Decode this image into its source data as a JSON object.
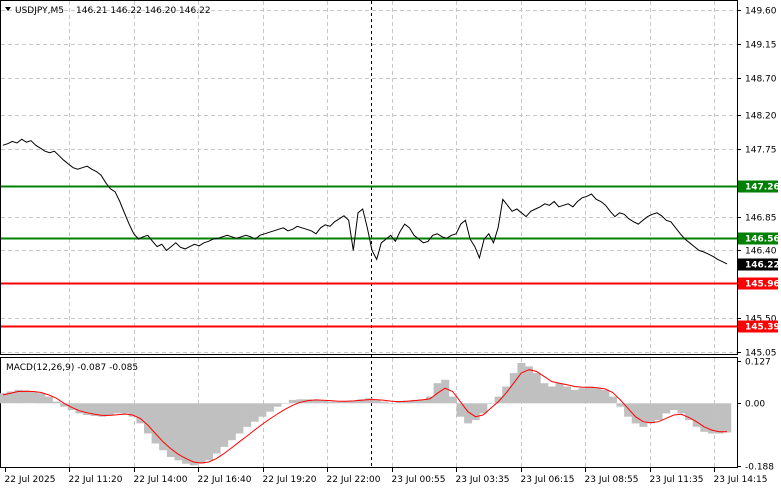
{
  "header": {
    "symbol": "USDJPY,M5",
    "ohlc": "146.21 146.22 146.20 146.22"
  },
  "price_axis": {
    "ticks": [
      "149.60",
      "149.15",
      "148.70",
      "148.20",
      "147.75",
      "147.26",
      "146.85",
      "146.56",
      "146.40",
      "146.22",
      "145.96",
      "145.50",
      "145.39",
      "145.05"
    ],
    "range": [
      145.02,
      149.72
    ]
  },
  "levels": [
    {
      "name": "resistance-upper",
      "value": 147.26,
      "label": "147.26",
      "color": "#008000"
    },
    {
      "name": "resistance-lower",
      "value": 146.56,
      "label": "146.56",
      "color": "#008000"
    },
    {
      "name": "support-upper",
      "value": 145.96,
      "label": "145.96",
      "color": "#ff0000"
    },
    {
      "name": "support-lower",
      "value": 145.39,
      "label": "145.39",
      "color": "#ff0000"
    }
  ],
  "current_price": {
    "label": "146.22",
    "color": "#000000"
  },
  "macd": {
    "title": "MACD(12,26,9) -0.087 -0.085",
    "ticks": [
      "0.127",
      "0.00",
      "-0.188"
    ],
    "range": [
      -0.19,
      0.135
    ],
    "histogram_color": "#c0c0c0",
    "signal_color": "#ff0000"
  },
  "time_axis": {
    "labels": [
      "22 Jul 2025",
      "22 Jul 11:20",
      "22 Jul 14:00",
      "22 Jul 16:40",
      "22 Jul 19:20",
      "22 Jul 22:00",
      "23 Jul 00:55",
      "23 Jul 03:35",
      "23 Jul 06:15",
      "23 Jul 08:55",
      "23 Jul 11:35",
      "23 Jul 14:15"
    ]
  },
  "chart_data": [
    {
      "type": "line",
      "title": "USDJPY,M5",
      "y_range": [
        145.02,
        149.72
      ],
      "x": [
        0,
        3,
        6,
        9,
        12,
        15,
        18,
        21,
        24,
        27,
        30,
        33,
        36,
        39,
        42,
        45,
        48,
        51,
        54,
        57,
        60,
        63,
        66,
        69,
        72,
        75,
        78,
        81,
        84,
        87,
        90,
        93,
        96,
        99,
        102,
        105,
        108,
        111,
        114,
        117,
        120,
        123,
        126,
        129,
        132,
        135,
        138,
        141,
        144,
        147,
        150,
        153,
        156,
        159,
        162,
        165,
        168,
        171,
        174,
        177,
        180,
        183,
        186,
        189,
        192,
        195,
        198,
        201,
        204,
        207,
        210,
        213,
        216,
        219,
        222,
        225,
        228,
        231,
        234,
        237,
        240,
        243,
        246,
        249,
        252,
        255,
        258,
        261,
        264,
        267,
        270,
        273,
        276,
        279,
        282,
        285,
        288,
        291
      ],
      "series": [
        {
          "values": [
            147.8,
            147.82,
            147.85,
            147.83,
            147.88,
            147.84,
            147.86,
            147.8,
            147.76,
            147.72,
            147.7,
            147.72,
            147.66,
            147.6,
            147.55,
            147.5,
            147.48,
            147.5,
            147.52,
            147.48,
            147.45,
            147.4,
            147.3,
            147.22,
            147.18,
            147.05,
            146.9,
            146.75,
            146.62,
            146.55,
            146.58,
            146.6,
            146.52,
            146.45,
            146.48,
            146.4,
            146.45,
            146.5,
            146.44,
            146.42,
            146.45,
            146.48,
            146.46,
            146.5,
            146.52,
            146.55,
            146.56,
            146.58,
            146.6,
            146.58,
            146.56,
            146.58,
            146.6,
            146.58,
            146.55,
            146.6,
            146.62,
            146.64,
            146.66,
            146.68,
            146.7,
            146.66,
            146.68,
            146.72,
            146.7,
            146.68,
            146.66,
            146.62,
            146.7,
            146.74,
            146.72,
            146.78,
            146.82,
            146.86,
            146.8,
            146.4,
            146.9,
            146.95,
            146.7,
            146.4,
            146.28,
            146.5,
            146.55,
            146.6,
            146.52,
            146.65,
            146.75,
            146.7,
            146.6,
            146.55,
            146.5,
            146.52,
            146.6,
            146.62,
            146.58,
            146.56,
            146.6,
            146.62
          ]
        }
      ],
      "overlay": {
        "segment2_values": [
          146.75,
          146.8,
          146.55,
          146.45,
          146.3,
          146.55,
          146.62,
          146.5,
          146.7,
          147.08,
          147.0,
          146.92,
          146.95,
          146.9,
          146.85,
          146.92,
          146.95,
          146.98,
          147.02,
          147.0,
          147.05,
          146.98,
          147.0,
          147.02,
          146.98,
          147.05,
          147.1,
          147.12,
          147.15,
          147.08,
          147.05,
          147.0,
          146.92,
          146.85,
          146.9,
          146.88,
          146.82,
          146.78,
          146.75,
          146.8,
          146.85,
          146.88,
          146.9,
          146.86,
          146.8,
          146.78,
          146.7,
          146.62,
          146.55,
          146.5,
          146.45,
          146.4,
          146.38,
          146.35,
          146.32,
          146.28,
          146.25,
          146.22
        ]
      }
    },
    {
      "type": "bar",
      "title": "MACD(12,26,9) -0.087 -0.085",
      "y_range": [
        -0.19,
        0.135
      ],
      "series": [
        {
          "name": "MACD",
          "values": [
            0.03,
            0.035,
            0.04,
            0.038,
            0.035,
            0.03,
            0.02,
            0.005,
            -0.01,
            -0.02,
            -0.03,
            -0.035,
            -0.038,
            -0.04,
            -0.035,
            -0.03,
            -0.03,
            -0.04,
            -0.06,
            -0.09,
            -0.12,
            -0.14,
            -0.16,
            -0.17,
            -0.18,
            -0.185,
            -0.18,
            -0.17,
            -0.15,
            -0.13,
            -0.11,
            -0.09,
            -0.07,
            -0.055,
            -0.04,
            -0.025,
            -0.01,
            0.0,
            0.01,
            0.012,
            0.012,
            0.01,
            0.008,
            0.005,
            0.004,
            0.006,
            0.008,
            0.012,
            0.015,
            0.01,
            0.005,
            0.0,
            0.005,
            0.008,
            0.01,
            0.012,
            0.02,
            0.06,
            0.07,
            0.02,
            -0.04,
            -0.06,
            -0.05,
            -0.03,
            0.0,
            0.02,
            0.05,
            0.09,
            0.12,
            0.11,
            0.09,
            0.06,
            0.05,
            0.06,
            0.05,
            0.04,
            0.045,
            0.05,
            0.045,
            0.04,
            0.02,
            -0.01,
            -0.04,
            -0.06,
            -0.07,
            -0.06,
            -0.05,
            -0.03,
            -0.02,
            -0.03,
            -0.05,
            -0.07,
            -0.085,
            -0.09,
            -0.09,
            -0.087
          ]
        },
        {
          "name": "Signal",
          "values": [
            0.025,
            0.03,
            0.035,
            0.036,
            0.035,
            0.032,
            0.025,
            0.015,
            0.0,
            -0.012,
            -0.022,
            -0.028,
            -0.033,
            -0.036,
            -0.036,
            -0.034,
            -0.032,
            -0.035,
            -0.045,
            -0.065,
            -0.09,
            -0.115,
            -0.135,
            -0.152,
            -0.165,
            -0.175,
            -0.178,
            -0.175,
            -0.165,
            -0.15,
            -0.133,
            -0.115,
            -0.098,
            -0.08,
            -0.063,
            -0.047,
            -0.032,
            -0.018,
            -0.006,
            0.003,
            0.008,
            0.01,
            0.009,
            0.008,
            0.006,
            0.006,
            0.007,
            0.009,
            0.011,
            0.011,
            0.009,
            0.006,
            0.005,
            0.006,
            0.008,
            0.01,
            0.013,
            0.03,
            0.045,
            0.035,
            0.005,
            -0.025,
            -0.04,
            -0.035,
            -0.015,
            0.005,
            0.03,
            0.06,
            0.09,
            0.1,
            0.095,
            0.08,
            0.065,
            0.06,
            0.055,
            0.05,
            0.048,
            0.048,
            0.046,
            0.043,
            0.032,
            0.01,
            -0.015,
            -0.04,
            -0.055,
            -0.058,
            -0.055,
            -0.045,
            -0.035,
            -0.033,
            -0.042,
            -0.055,
            -0.07,
            -0.08,
            -0.085,
            -0.085
          ]
        }
      ]
    }
  ]
}
